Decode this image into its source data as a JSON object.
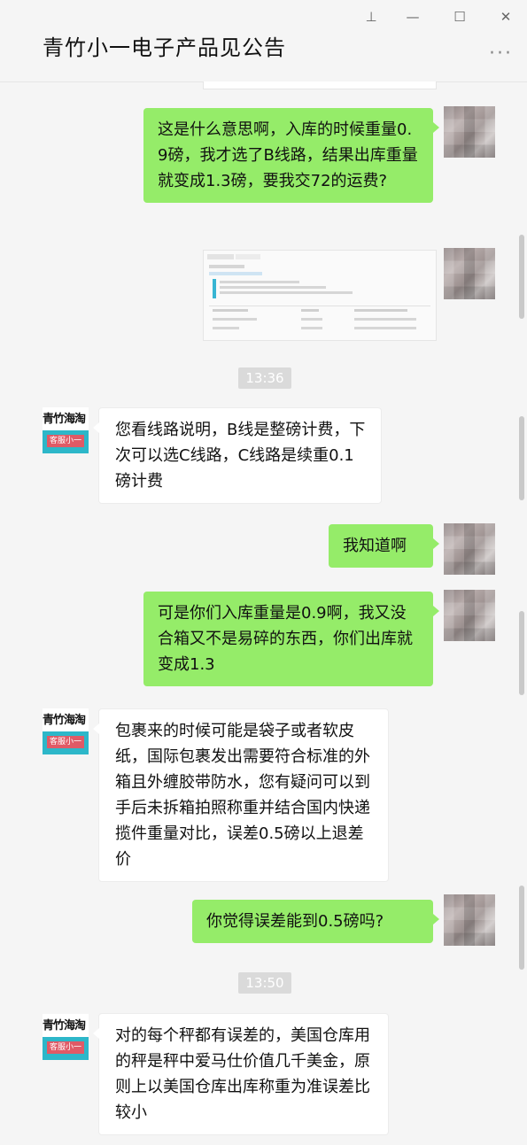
{
  "window": {
    "title": "青竹小一电子产品见公告",
    "controls": {
      "pin": "⊥",
      "minimize": "—",
      "maximize": "☐",
      "close": "✕"
    },
    "more": "···"
  },
  "messages": [
    {
      "type": "me",
      "text": "这是什么意思啊，入库的时候重量0.9磅，我才选了B线路，结果出库重量就变成1.3磅，要我交72的运费?"
    },
    {
      "type": "me_image",
      "description": "screenshot"
    },
    {
      "type": "time",
      "text": "13:36"
    },
    {
      "type": "cs",
      "text": "您看线路说明，B线是整磅计费，下次可以选C线路，C线路是续重0.1磅计费"
    },
    {
      "type": "me",
      "text": "我知道啊"
    },
    {
      "type": "me",
      "text": "可是你们入库重量是0.9啊，我又没合箱又不是易碎的东西，你们出库就变成1.3"
    },
    {
      "type": "cs",
      "text": "包裹来的时候可能是袋子或者软皮纸，国际包裹发出需要符合标准的外箱且外缠胶带防水，您有疑问可以到手后未拆箱拍照称重并结合国内快递揽件重量对比，误差0.5磅以上退差价"
    },
    {
      "type": "me",
      "text": "你觉得误差能到0.5磅吗?"
    },
    {
      "type": "time",
      "text": "13:50"
    },
    {
      "type": "cs",
      "text": "对的每个秤都有误差的，美国仓库用的秤是秤中爱马仕价值几千美金，原则上以美国仓库出库称重为准误差比较小"
    }
  ],
  "cs_avatar": {
    "top_text": "青竹海淘",
    "tag": "客服小一"
  },
  "colors": {
    "me_bubble": "#95ec69",
    "cs_bubble": "#ffffff",
    "background": "#f5f5f5",
    "time_badge": "#dadada",
    "avatar_band": "#2db7c9",
    "avatar_tag": "#e05a66"
  }
}
